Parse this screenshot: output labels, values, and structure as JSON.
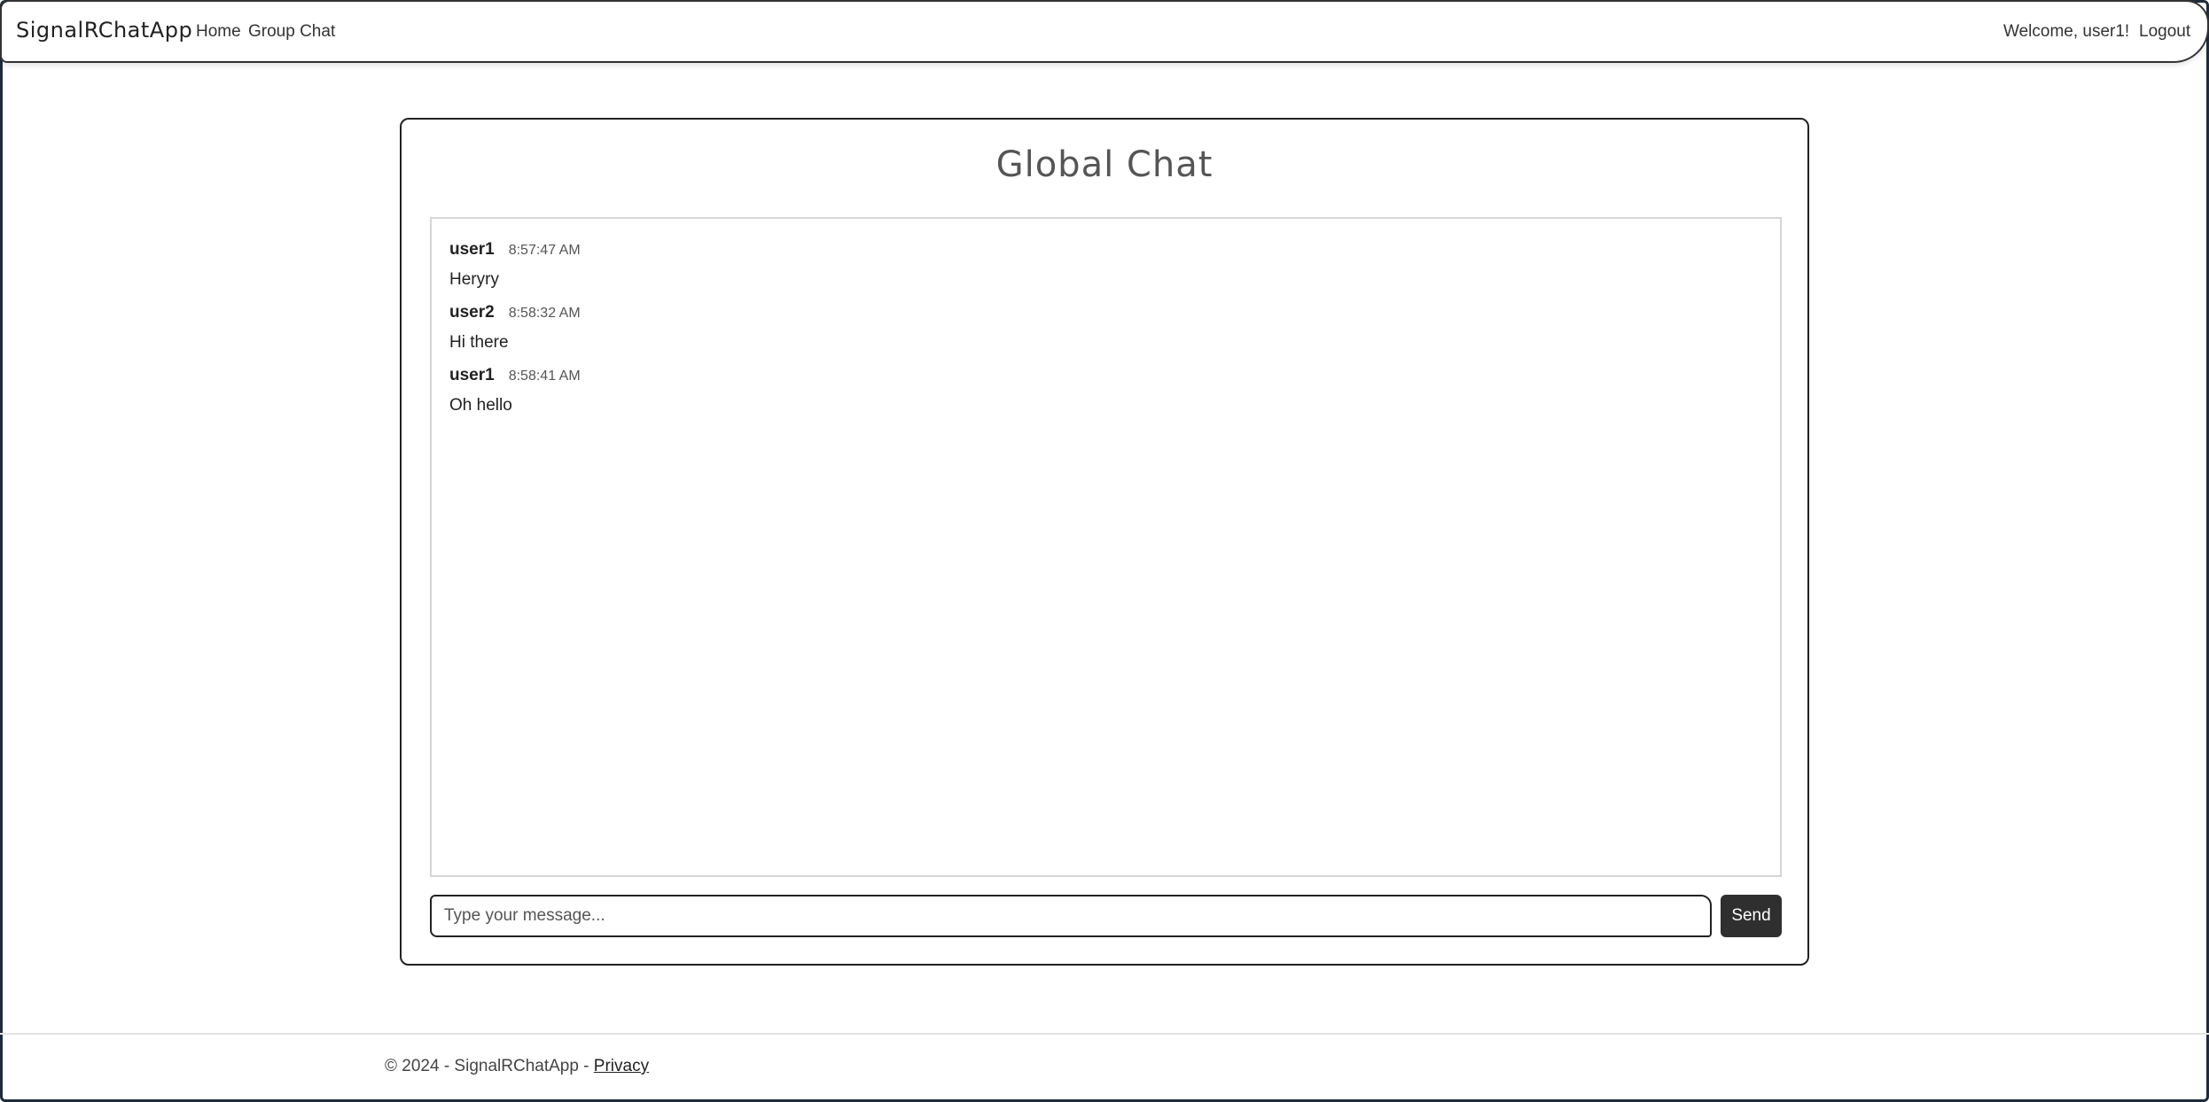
{
  "navbar": {
    "brand": "SignalRChatApp",
    "links": [
      {
        "label": "Home"
      },
      {
        "label": "Group Chat"
      }
    ],
    "welcome": "Welcome, user1!",
    "logout_label": "Logout"
  },
  "chat": {
    "title": "Global Chat",
    "messages": [
      {
        "user": "user1",
        "time": "8:57:47 AM",
        "text": "Heryry"
      },
      {
        "user": "user2",
        "time": "8:58:32 AM",
        "text": "Hi there"
      },
      {
        "user": "user1",
        "time": "8:58:41 AM",
        "text": "Oh hello"
      }
    ],
    "input_placeholder": "Type your message...",
    "input_value": "",
    "send_label": "Send"
  },
  "footer": {
    "text": "© 2024 - SignalRChatApp - ",
    "privacy_label": "Privacy"
  }
}
